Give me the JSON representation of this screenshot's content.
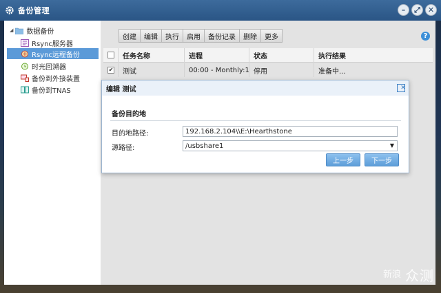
{
  "window": {
    "title": "备份管理"
  },
  "sidebar": {
    "items": [
      {
        "label": "数据备份",
        "icon": "folder-icon"
      },
      {
        "label": "Rsync服务器",
        "icon": "rsync-server-icon"
      },
      {
        "label": "Rsync远程备份",
        "icon": "rsync-remote-icon",
        "selected": true
      },
      {
        "label": "时光回溯器",
        "icon": "time-machine-icon"
      },
      {
        "label": "备份到外接装置",
        "icon": "external-device-icon"
      },
      {
        "label": "备份到TNAS",
        "icon": "tnas-icon"
      }
    ]
  },
  "toolbar": {
    "buttons": [
      "创建",
      "编辑",
      "执行",
      "启用",
      "备份记录",
      "删除",
      "更多"
    ]
  },
  "grid": {
    "headers": [
      "任务名称",
      "进程",
      "状态",
      "执行结果"
    ],
    "rows": [
      {
        "name": "测试",
        "process": "00:00 - Monthly:1",
        "status": "停用",
        "result": "准备中..."
      }
    ]
  },
  "dialog": {
    "title": "编辑 测试",
    "section": "备份目的地",
    "fields": {
      "dest_label": "目的地路径:",
      "dest_value": "192.168.2.104\\\\E:\\Hearthstone",
      "src_label": "源路径:",
      "src_value": "/usbshare1"
    },
    "buttons": {
      "prev": "上一步",
      "next": "下一步"
    }
  },
  "watermark": {
    "small": "新浪",
    "big": "众测"
  },
  "colors": {
    "accent": "#5b9ad8",
    "titlebar": "#2f5f92"
  }
}
